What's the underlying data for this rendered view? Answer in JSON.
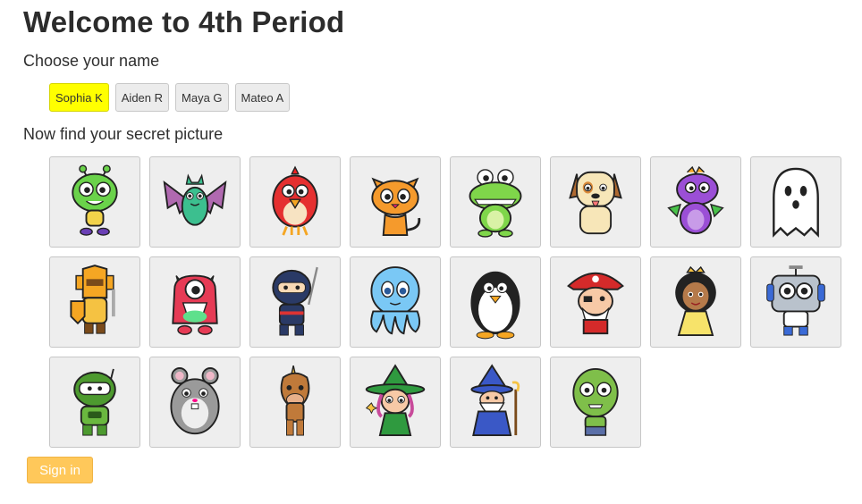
{
  "header": {
    "title": "Welcome to 4th Period",
    "choose_label": "Choose your name",
    "picture_label": "Now find your secret picture"
  },
  "names": [
    {
      "label": "Sophia K",
      "selected": true
    },
    {
      "label": "Aiden R",
      "selected": false
    },
    {
      "label": "Maya G",
      "selected": false
    },
    {
      "label": "Mateo A",
      "selected": false
    }
  ],
  "pictures": [
    {
      "icon": "alien-icon"
    },
    {
      "icon": "bat-icon"
    },
    {
      "icon": "red-bird-icon"
    },
    {
      "icon": "orange-cat-icon"
    },
    {
      "icon": "crocodile-icon"
    },
    {
      "icon": "dog-icon"
    },
    {
      "icon": "purple-dragon-icon"
    },
    {
      "icon": "ghost-icon"
    },
    {
      "icon": "knight-icon"
    },
    {
      "icon": "red-monster-icon"
    },
    {
      "icon": "ninja-icon"
    },
    {
      "icon": "octopus-icon"
    },
    {
      "icon": "penguin-icon"
    },
    {
      "icon": "pirate-icon"
    },
    {
      "icon": "princess-icon"
    },
    {
      "icon": "robot-icon"
    },
    {
      "icon": "green-robot-icon"
    },
    {
      "icon": "hamster-icon"
    },
    {
      "icon": "unicorn-icon"
    },
    {
      "icon": "witch-icon"
    },
    {
      "icon": "wizard-icon"
    },
    {
      "icon": "zombie-icon"
    }
  ],
  "signin": {
    "label": "Sign in"
  },
  "colors": {
    "selected": "#ffff00",
    "signin": "#ffc85a",
    "tile_bg": "#eeeeee"
  }
}
